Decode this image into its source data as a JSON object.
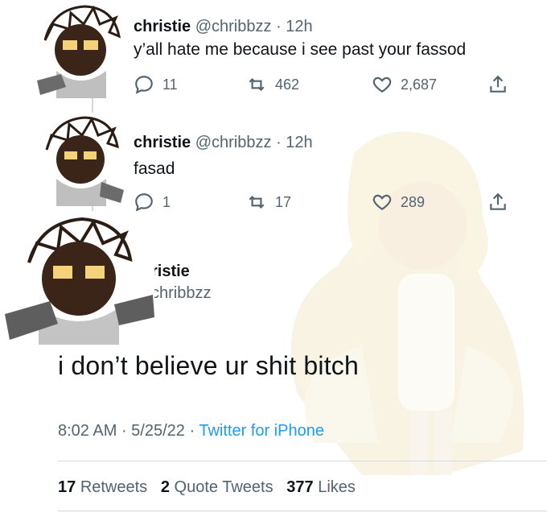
{
  "tweets": [
    {
      "name": "christie",
      "handle": "@chribbzz",
      "time": "12h",
      "text": "y’all hate me because i see past your fassod",
      "replies": "11",
      "retweets": "462",
      "likes": "2,687"
    },
    {
      "name": "christie",
      "handle": "@chribbzz",
      "time": "12h",
      "text": "fasad",
      "replies": "1",
      "retweets": "17",
      "likes": "289"
    }
  ],
  "main_tweet": {
    "name_partial": "ristie",
    "handle_partial": "chribbzz",
    "text": "i don’t believe ur shit bitch",
    "time": "8:02 AM",
    "date": "5/25/22",
    "source": "Twitter for iPhone",
    "retweets_count": "17",
    "retweets_label": "Retweets",
    "quotes_count": "2",
    "quotes_label": "Quote Tweets",
    "likes_count": "377",
    "likes_label": "Likes"
  },
  "icons": [
    "reply-icon",
    "retweet-icon",
    "like-icon",
    "share-icon"
  ],
  "colors": {
    "text": "#0f1419",
    "secondary": "#536471",
    "link": "#1d9bf0",
    "divider": "#cfd9de"
  }
}
